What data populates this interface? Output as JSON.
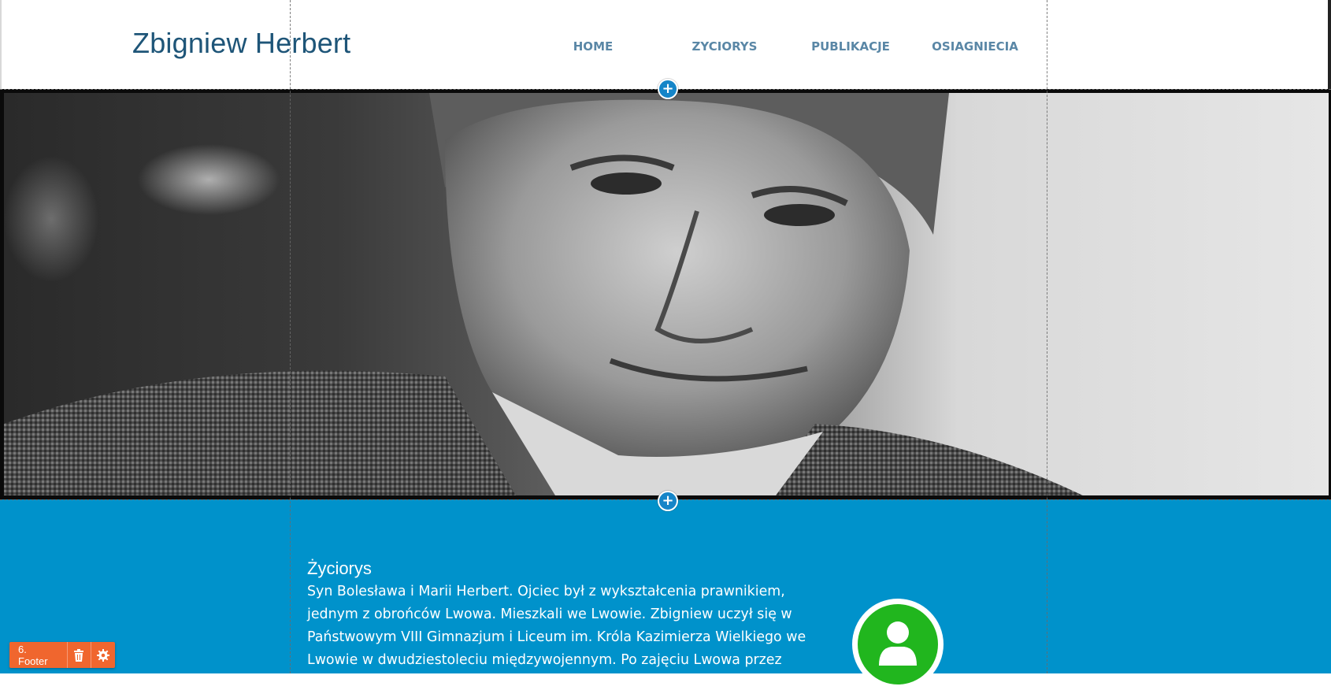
{
  "header": {
    "site_title": "Zbigniew Herbert",
    "nav": [
      {
        "label": "HOME"
      },
      {
        "label": "ZYCIORYS"
      },
      {
        "label": "PUBLIKACJE"
      },
      {
        "label": "OSIAGNIECIA"
      }
    ]
  },
  "hero": {
    "image_alt": "black-and-white portrait photo"
  },
  "biography": {
    "heading": "Życiorys",
    "lines": [
      "Syn Bolesława i Marii Herbert. Ojciec był z wykształcenia prawnikiem,",
      "jednym z obrońców Lwowa. Mieszkali we Lwowie. Zbigniew uczył się w",
      "Państwowym VIII Gimnazjum i Liceum im. Króla Kazimierza Wielkiego we",
      "Lwowie w dwudziestoleciu międzywojennym. Po zajęciu Lwowa przez"
    ],
    "avatar_icon": "user-icon"
  },
  "editor": {
    "add_section_icon": "plus-icon",
    "toolbar": {
      "label": "6. Footer",
      "delete_icon": "trash-icon",
      "settings_icon": "gear-icon"
    }
  },
  "colors": {
    "title": "#1e5578",
    "nav": "#5a87a6",
    "section_bg": "#0092cb",
    "avatar": "#21b61e",
    "toolbar": "#f0662e",
    "add_button": "#1585c8"
  }
}
